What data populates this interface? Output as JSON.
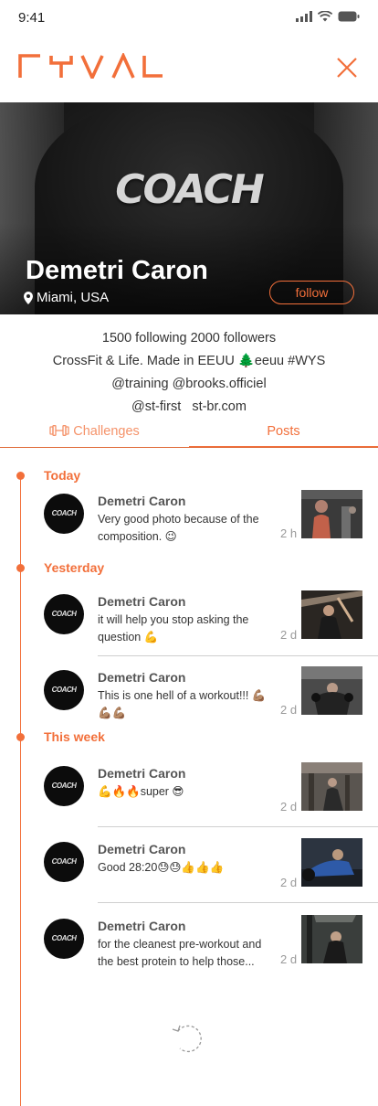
{
  "status_bar": {
    "time": "9:41"
  },
  "brand": {
    "logo": "RYVAL",
    "accent": "#f26f3a"
  },
  "hero": {
    "shirt_text": "COACH",
    "name": "Demetri Caron",
    "location": "Miami, USA",
    "follow_label": "follow"
  },
  "profile": {
    "stats": "1500 following 2000 followers",
    "bio": "CrossFit & Life. Made in EEUU 🌲eeuu #WYS",
    "mentions": "@training @brooks.officiel",
    "links": "@st-first   st-br.com"
  },
  "tabs": [
    {
      "label": "Challenges",
      "icon": "dumbbell-icon",
      "active": false
    },
    {
      "label": "Posts",
      "active": true
    }
  ],
  "sections": [
    {
      "label": "Today"
    },
    {
      "label": "Yesterday"
    },
    {
      "label": "This week"
    }
  ],
  "posts": [
    {
      "author": "Demetri Caron",
      "avatar_text": "COACH",
      "text": "Very good photo because of the composition. 😉",
      "time": "2 h"
    },
    {
      "author": "Demetri Caron",
      "avatar_text": "COACH",
      "text": " it will help you stop asking the question 💪",
      "time": "2 d"
    },
    {
      "author": "Demetri Caron",
      "avatar_text": "COACH",
      "text": "This is one hell of a workout!!! 💪🏽💪🏽💪🏽",
      "time": "2 d"
    },
    {
      "author": "Demetri Caron",
      "avatar_text": "COACH",
      "text": "💪🔥🔥super 😎",
      "time": "2 d"
    },
    {
      "author": "Demetri Caron",
      "avatar_text": "COACH",
      "text": "Good 28:20😓😓👍👍👍",
      "time": "2 d"
    },
    {
      "author": "Demetri Caron",
      "avatar_text": "COACH",
      "text": " for the cleanest pre-workout and the best protein to help those...",
      "time": "2 d"
    }
  ]
}
